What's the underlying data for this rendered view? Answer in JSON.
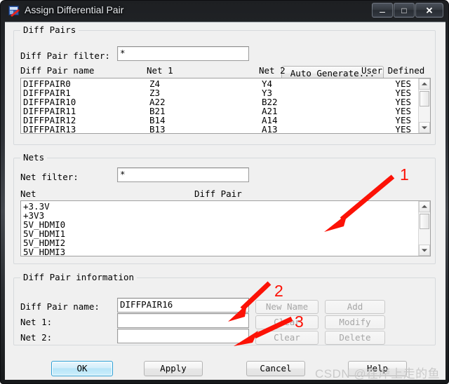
{
  "window": {
    "title": "Assign Differential Pair",
    "icon": "app-icon",
    "controls": {
      "minimize": "–",
      "maximize": "□",
      "close": "✕"
    }
  },
  "diff_pairs_group": {
    "legend": "Diff Pairs",
    "filter_label": "Diff Pair filter:",
    "filter_value": "*",
    "auto_generate_label": "Auto Generate...",
    "columns": {
      "name": "Diff Pair name",
      "net1": "Net 1",
      "net2": "Net 2",
      "user_defined": "User Defined"
    },
    "rows": [
      {
        "name": "DIFFPAIR0",
        "net1": "Z4",
        "net2": "Y4",
        "user_defined": "YES"
      },
      {
        "name": "DIFFPAIR1",
        "net1": "Z3",
        "net2": "Y3",
        "user_defined": "YES"
      },
      {
        "name": "DIFFPAIR10",
        "net1": "A22",
        "net2": "B22",
        "user_defined": "YES"
      },
      {
        "name": "DIFFPAIR11",
        "net1": "B21",
        "net2": "A21",
        "user_defined": "YES"
      },
      {
        "name": "DIFFPAIR12",
        "net1": "B14",
        "net2": "A14",
        "user_defined": "YES"
      },
      {
        "name": "DIFFPAIR13",
        "net1": "B13",
        "net2": "A13",
        "user_defined": "YES"
      }
    ]
  },
  "nets_group": {
    "legend": "Nets",
    "filter_label": "Net filter:",
    "filter_value": "*",
    "columns": {
      "net": "Net",
      "diff_pair": "Diff Pair"
    },
    "rows": [
      {
        "net": "+3.3V",
        "diff_pair": ""
      },
      {
        "net": "+3V3",
        "diff_pair": ""
      },
      {
        "net": "5V_HDMI0",
        "diff_pair": ""
      },
      {
        "net": "5V_HDMI1",
        "diff_pair": ""
      },
      {
        "net": "5V_HDMI2",
        "diff_pair": ""
      },
      {
        "net": "5V_HDMI3",
        "diff_pair": ""
      }
    ]
  },
  "info_group": {
    "legend": "Diff Pair information",
    "name_label": "Diff Pair name:",
    "name_value": "DIFFPAIR16",
    "net1_label": "Net 1:",
    "net1_value": "",
    "net2_label": "Net 2:",
    "net2_value": "",
    "buttons": {
      "new_name": "New Name",
      "clear_name": "Clear",
      "clear_nets": "Clear",
      "add": "Add",
      "modify": "Modify",
      "delete": "Delete"
    }
  },
  "footer": {
    "ok": "OK",
    "apply": "Apply",
    "cancel": "Cancel",
    "help": "Help"
  },
  "annotations": [
    {
      "id": "1",
      "label": "1"
    },
    {
      "id": "2",
      "label": "2"
    },
    {
      "id": "3",
      "label": "3"
    }
  ],
  "watermark": "CSDN @在岸上走的鱼",
  "colors": {
    "annotation": "#fc1206",
    "dialog_bg": "#f0f0f0",
    "default_button_border": "#2a9fd6"
  }
}
